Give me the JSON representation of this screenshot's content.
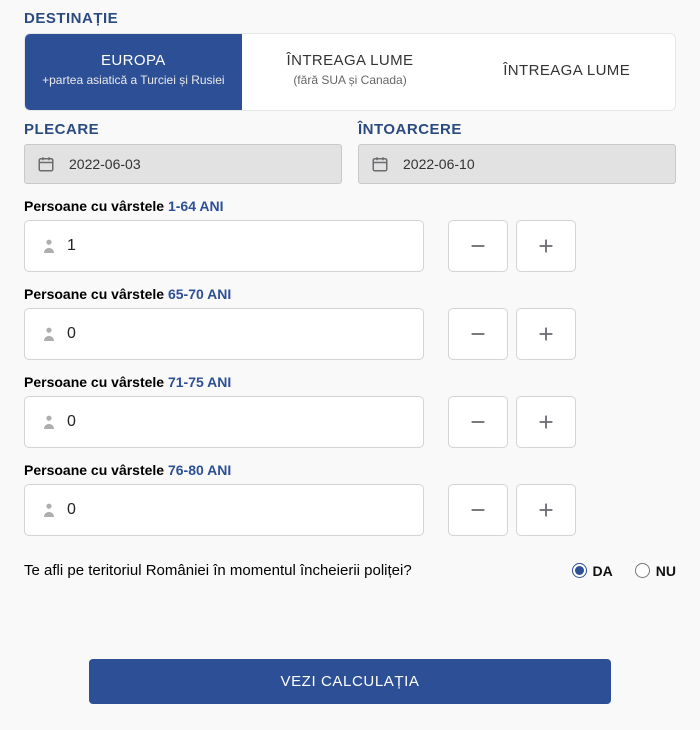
{
  "labels": {
    "destination": "DESTINAȚIE",
    "departure": "PLECARE",
    "return": "ÎNTOARCERE",
    "age_prefix": "Persoane cu vârstele ",
    "submit": "VEZI CALCULAȚIA",
    "question": "Te afli pe teritoriul României în momentul încheierii poliței?",
    "yes": "DA",
    "no": "NU"
  },
  "tabs": [
    {
      "title": "EUROPA",
      "sub": "+partea asiatică a Turciei și Rusiei"
    },
    {
      "title": "ÎNTREAGA LUME",
      "sub": "(fără SUA și Canada)"
    },
    {
      "title": "ÎNTREAGA LUME",
      "sub": ""
    }
  ],
  "dates": {
    "departure": "2022-06-03",
    "returnd": "2022-06-10"
  },
  "groups": [
    {
      "range": "1-64 ANI",
      "value": "1"
    },
    {
      "range": "65-70 ANI",
      "value": "0"
    },
    {
      "range": "71-75 ANI",
      "value": "0"
    },
    {
      "range": "76-80 ANI",
      "value": "0"
    }
  ],
  "in_romania": "DA"
}
